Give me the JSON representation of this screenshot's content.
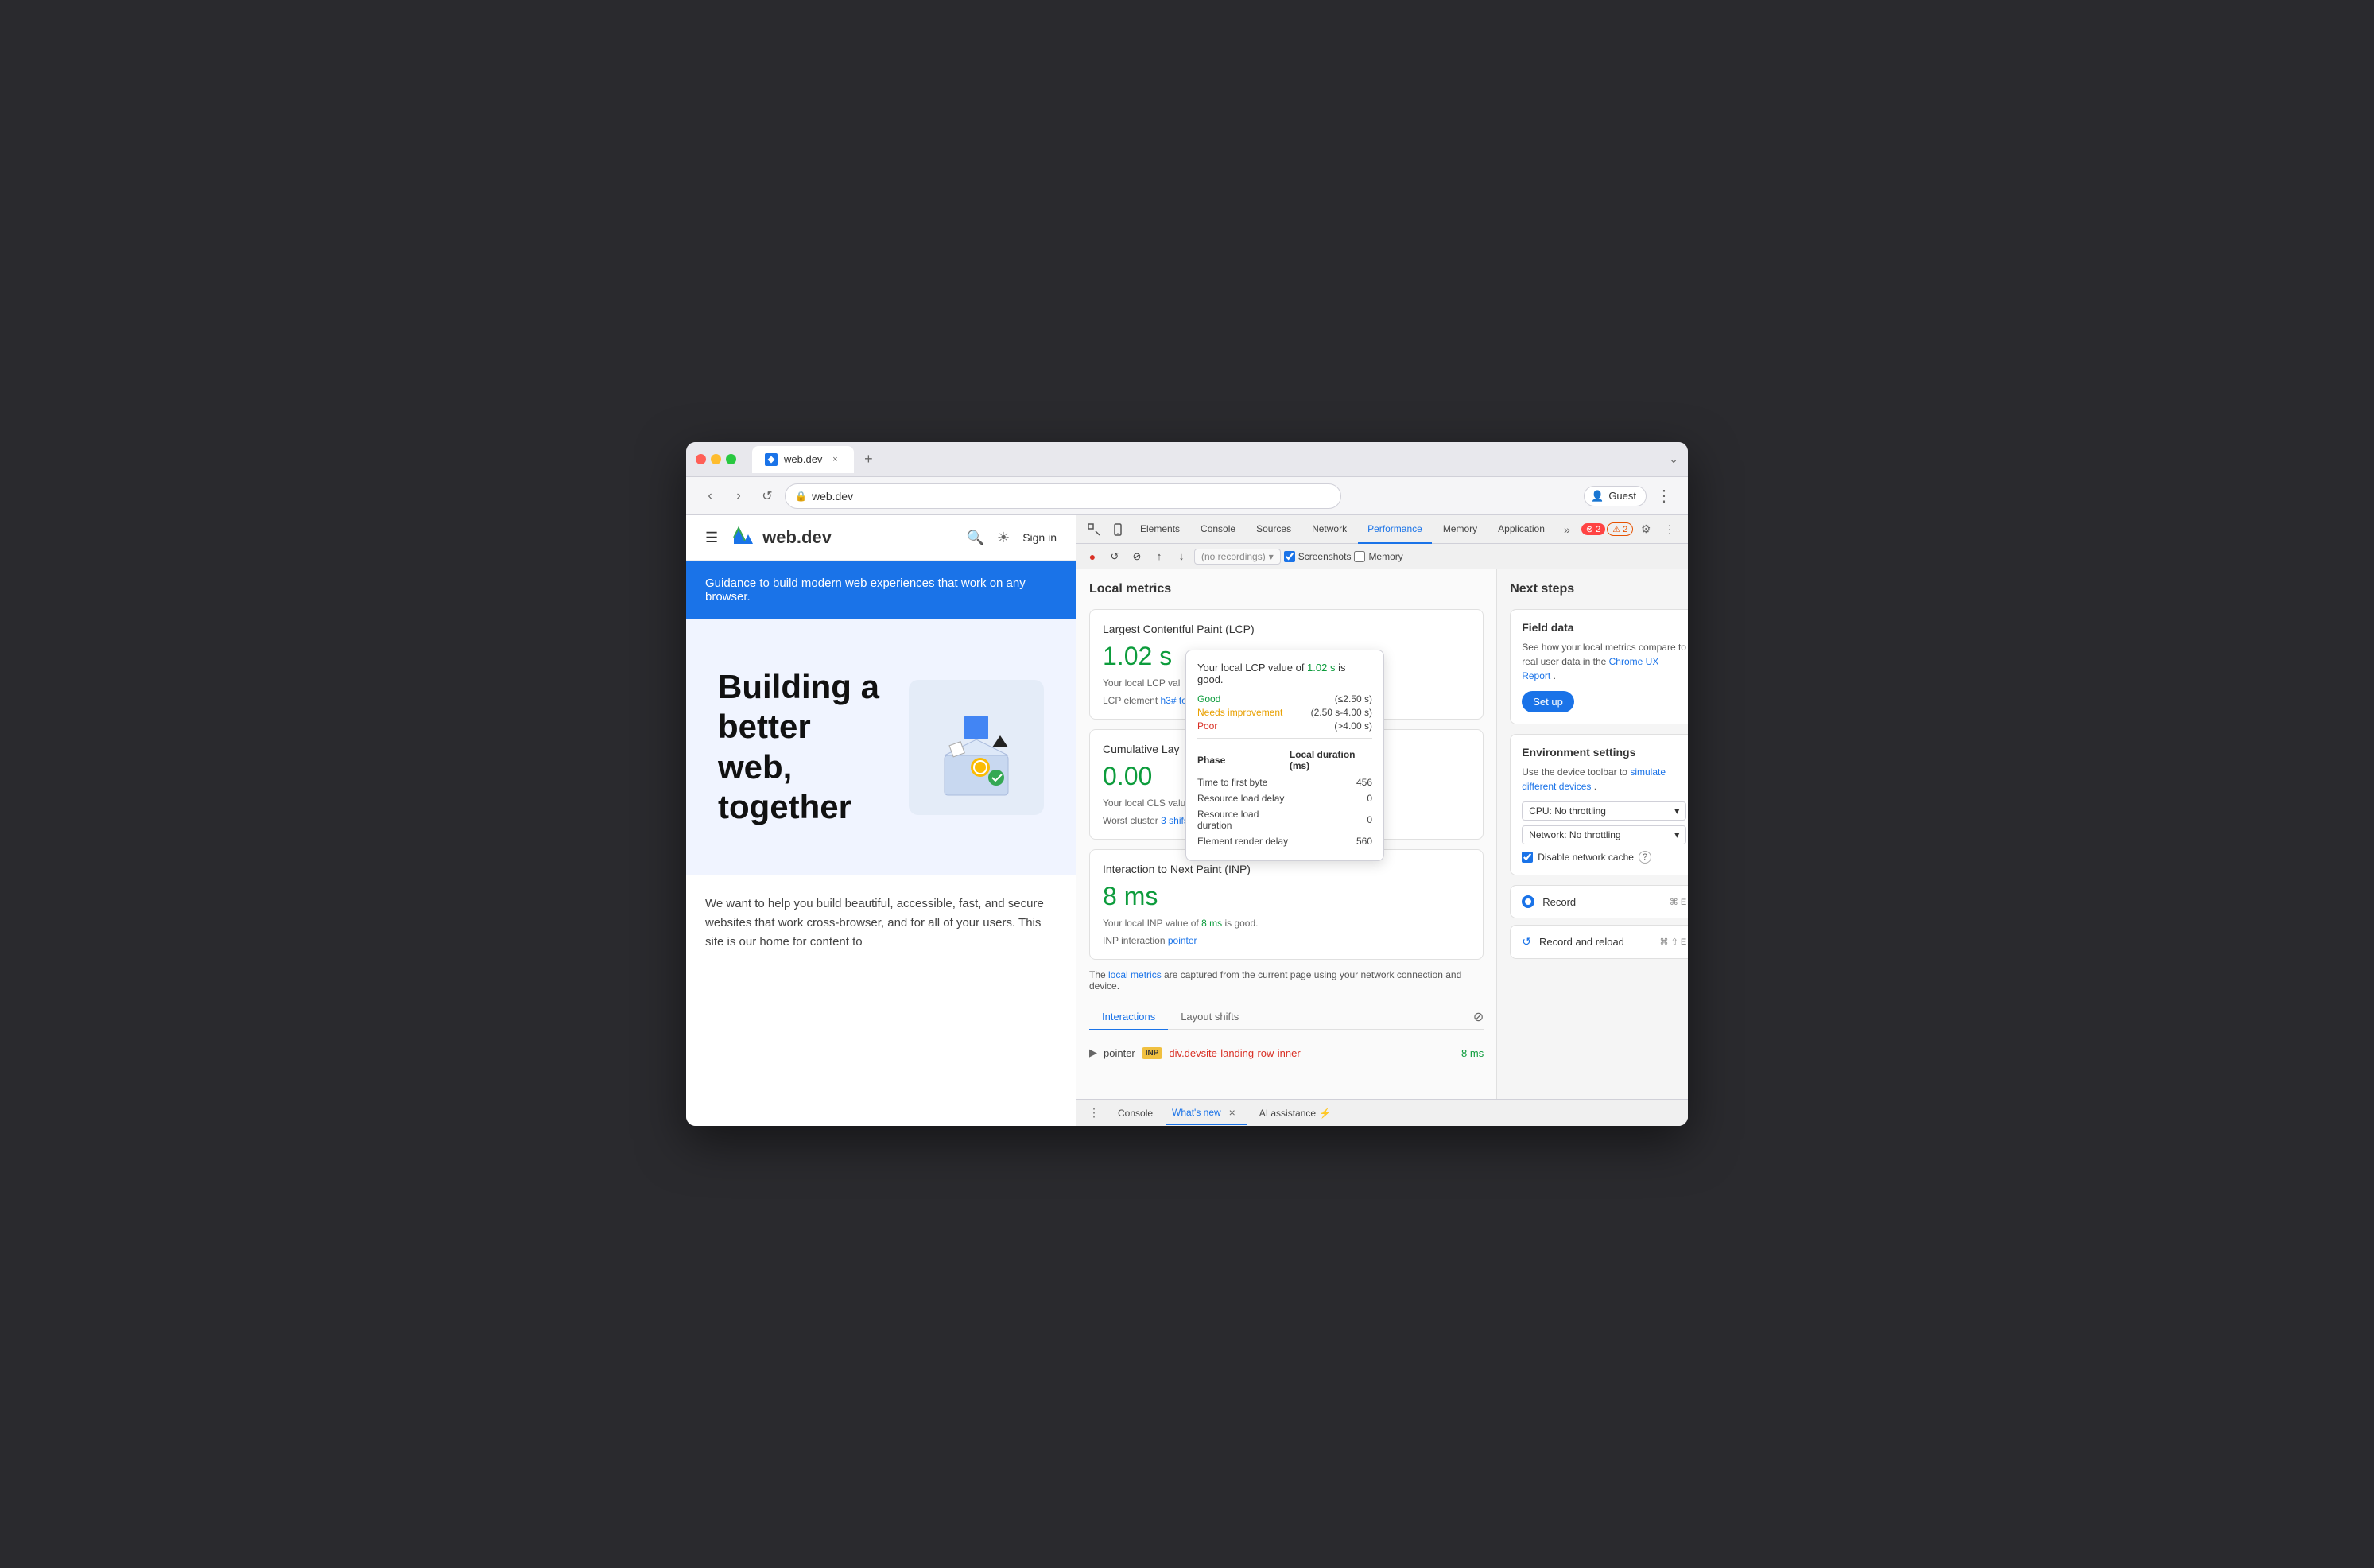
{
  "browser": {
    "tab": {
      "title": "web.dev",
      "favicon": "W",
      "close_label": "×",
      "new_tab_label": "+"
    },
    "address": {
      "url": "web.dev",
      "lock_icon": "🔒"
    },
    "user": "Guest",
    "more_label": "⋮",
    "chevron_down": "⌄"
  },
  "webpage": {
    "nav": {
      "hamburger": "☰",
      "logo_text": "web.dev",
      "search_icon": "🔍",
      "theme_icon": "☀",
      "signin": "Sign in"
    },
    "hero": {
      "header_text": "Guidance to build modern web experiences that work on any browser.",
      "title": "Building a better web, together",
      "body": "We want to help you build beautiful, accessible, fast, and secure websites that work cross-browser, and for all of your users. This site is our home for content to"
    }
  },
  "devtools": {
    "toolbar": {
      "inspect_icon": "⊡",
      "device_icon": "📱",
      "tabs": [
        "Elements",
        "Console",
        "Sources",
        "Network",
        "Performance",
        "Memory",
        "Application"
      ],
      "more_tabs": "»",
      "error_count": "2",
      "warn_count": "2",
      "settings_icon": "⚙",
      "more_icon": "⋮",
      "close_icon": "×"
    },
    "subtoolbar": {
      "record_icon": "●",
      "reload_icon": "↺",
      "clear_icon": "🚫",
      "upload_icon": "↑",
      "download_icon": "↓",
      "recordings_placeholder": "(no recordings)",
      "screenshots_label": "Screenshots",
      "memory_label": "Memory"
    },
    "performance": {
      "title": "Local metrics",
      "lcp": {
        "name": "Largest Contentful Paint (LCP)",
        "value": "1.02 s",
        "desc_prefix": "Your local LCP val",
        "desc_element": "LCP element",
        "element_ref": "h3#",
        "link_text": "toc.no-link"
      },
      "cls": {
        "name": "Cumulative Lay",
        "value": "0.00",
        "desc_prefix": "Your local CLS valu",
        "worst_cluster_prefix": "Worst cluster",
        "worst_cluster_link": "3 shifs"
      },
      "inp": {
        "name": "Interaction to Next Paint (INP)",
        "value": "8 ms",
        "desc_prefix": "Your local INP value of",
        "desc_value": "8 ms",
        "desc_suffix": "is good.",
        "interaction_label": "INP interaction",
        "interaction_link": "pointer"
      },
      "local_metrics_note": "The local metrics are captured from the current page using your network connection and device.",
      "local_metrics_link": "local metrics"
    },
    "tooltip": {
      "header": "Your local LCP value of 1.02 s is good.",
      "value_color": "1.02 s",
      "good_label": "Good",
      "good_range": "(≤2.50 s)",
      "needs_label": "Needs improvement",
      "needs_range": "(2.50 s-4.00 s)",
      "poor_label": "Poor",
      "poor_range": "(>4.00 s)",
      "table_col1": "Phase",
      "table_col2": "Local duration (ms)",
      "rows": [
        {
          "phase": "Time to first byte",
          "duration": "456"
        },
        {
          "phase": "Resource load delay",
          "duration": "0"
        },
        {
          "phase": "Resource load duration",
          "duration": "0"
        },
        {
          "phase": "Element render delay",
          "duration": "560"
        }
      ]
    },
    "interactions": {
      "tabs": [
        "Interactions",
        "Layout shifts"
      ],
      "filter_icon": "⊘",
      "rows": [
        {
          "arrow": "▶",
          "type": "pointer",
          "badge": "INP",
          "element": "div.devsite-landing-row-inner",
          "time": "8 ms"
        }
      ]
    },
    "next_steps": {
      "title": "Next steps",
      "field_data": {
        "title": "Field data",
        "text_prefix": "See how your local metrics compare to real user data in the",
        "link_text": "Chrome UX Report",
        "text_suffix": ".",
        "btn_label": "Set up"
      },
      "env_settings": {
        "title": "Environment settings",
        "text_prefix": "Use the device toolbar to",
        "link_text": "simulate different devices",
        "text_suffix": ".",
        "cpu_label": "CPU: No throttling",
        "cpu_arrow": "▾",
        "network_label": "Network: No throttling",
        "network_arrow": "▾",
        "disable_cache_label": "Disable network cache",
        "help_icon": "?"
      },
      "record": {
        "label": "Record",
        "shortcut": "⌘ E"
      },
      "record_reload": {
        "label": "Record and reload",
        "shortcut": "⌘ ⇧ E"
      }
    },
    "bottom_bar": {
      "more_icon": "⋮",
      "tabs": [
        "Console",
        "What's new",
        "AI assistance"
      ],
      "whats_new_close": "×",
      "close_all": "×"
    }
  }
}
